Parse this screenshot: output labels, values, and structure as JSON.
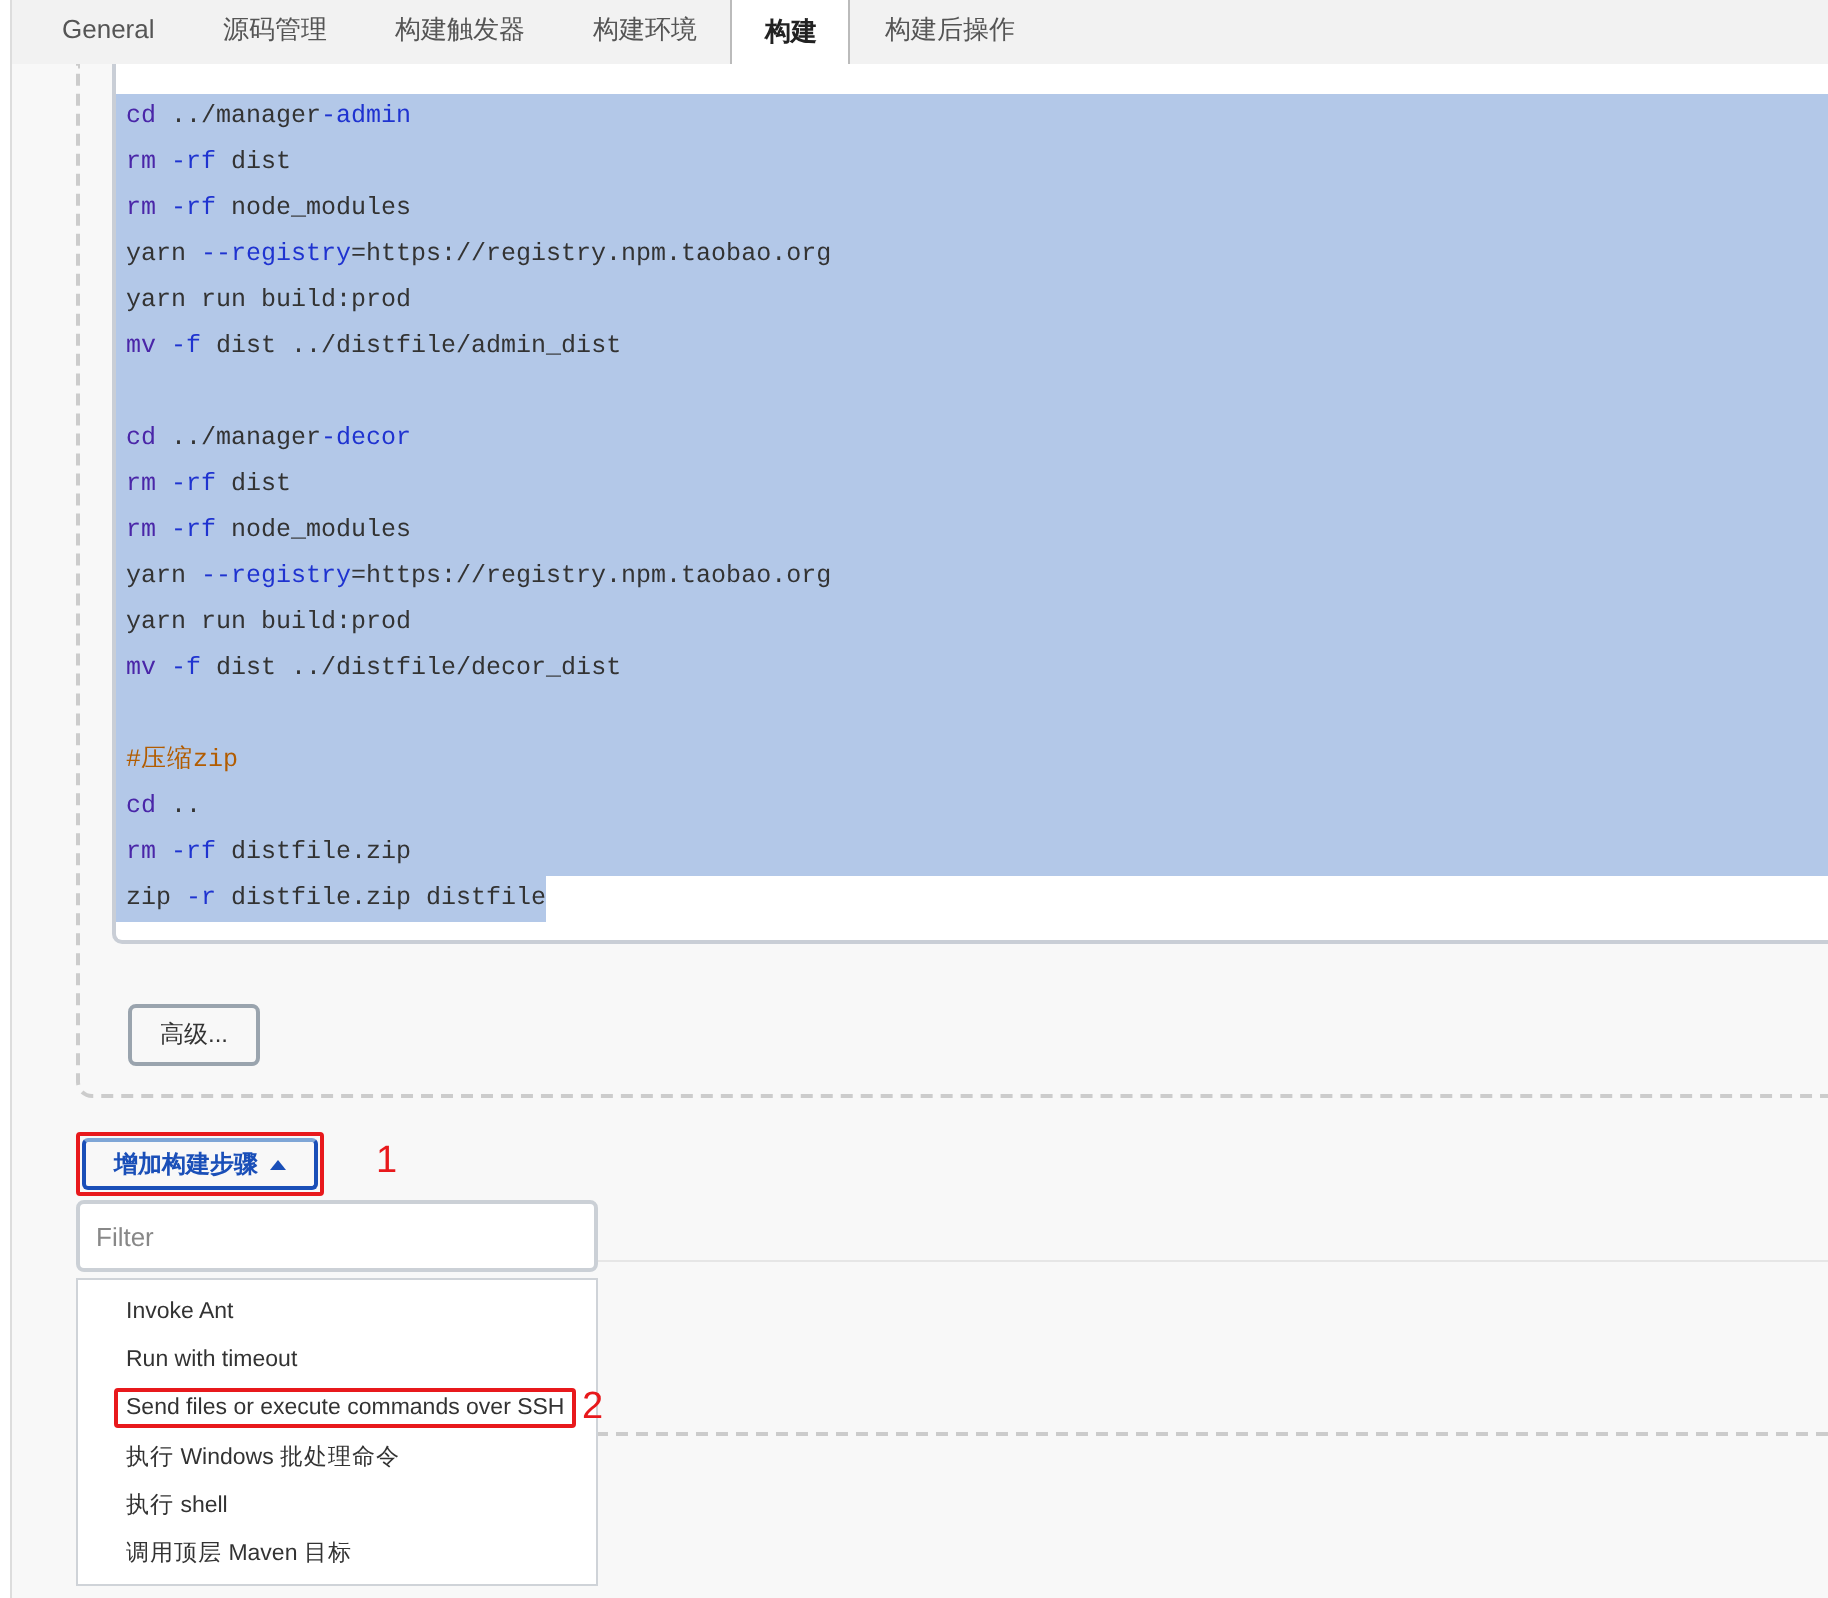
{
  "tabs": [
    {
      "label": "General",
      "selected": false
    },
    {
      "label": "源码管理",
      "selected": false
    },
    {
      "label": "构建触发器",
      "selected": false
    },
    {
      "label": "构建环境",
      "selected": false
    },
    {
      "label": "构建",
      "selected": true
    },
    {
      "label": "构建后操作",
      "selected": false
    }
  ],
  "code_editor": {
    "lines": [
      {
        "selected": true,
        "full_width": true,
        "segments": [
          {
            "text": "cd",
            "kind": "keyword"
          },
          {
            "text": " ../manager",
            "kind": "plain"
          },
          {
            "text": "-admin",
            "kind": "attr"
          }
        ]
      },
      {
        "selected": true,
        "full_width": true,
        "segments": [
          {
            "text": "rm",
            "kind": "keyword"
          },
          {
            "text": " -rf",
            "kind": "attr"
          },
          {
            "text": " dist",
            "kind": "plain"
          }
        ]
      },
      {
        "selected": true,
        "full_width": true,
        "segments": [
          {
            "text": "rm",
            "kind": "keyword"
          },
          {
            "text": " -rf",
            "kind": "attr"
          },
          {
            "text": " node_modules",
            "kind": "plain"
          }
        ]
      },
      {
        "selected": true,
        "full_width": true,
        "segments": [
          {
            "text": "yarn ",
            "kind": "plain"
          },
          {
            "text": "--registry",
            "kind": "attr"
          },
          {
            "text": "=https://registry.npm.taobao.org",
            "kind": "plain"
          }
        ]
      },
      {
        "selected": true,
        "full_width": true,
        "segments": [
          {
            "text": "yarn run build:prod",
            "kind": "plain"
          }
        ]
      },
      {
        "selected": true,
        "full_width": true,
        "segments": [
          {
            "text": "mv",
            "kind": "keyword"
          },
          {
            "text": " -f",
            "kind": "attr"
          },
          {
            "text": " dist ../distfile/admin_dist",
            "kind": "plain"
          }
        ]
      },
      {
        "selected": true,
        "full_width": true
      },
      {
        "selected": true,
        "full_width": true,
        "segments": [
          {
            "text": "cd",
            "kind": "keyword"
          },
          {
            "text": " ../manager",
            "kind": "plain"
          },
          {
            "text": "-decor",
            "kind": "attr"
          }
        ]
      },
      {
        "selected": true,
        "full_width": true,
        "segments": [
          {
            "text": "rm",
            "kind": "keyword"
          },
          {
            "text": " -rf",
            "kind": "attr"
          },
          {
            "text": " dist",
            "kind": "plain"
          }
        ]
      },
      {
        "selected": true,
        "full_width": true,
        "segments": [
          {
            "text": "rm",
            "kind": "keyword"
          },
          {
            "text": " -rf",
            "kind": "attr"
          },
          {
            "text": " node_modules",
            "kind": "plain"
          }
        ]
      },
      {
        "selected": true,
        "full_width": true,
        "segments": [
          {
            "text": "yarn ",
            "kind": "plain"
          },
          {
            "text": "--registry",
            "kind": "attr"
          },
          {
            "text": "=https://registry.npm.taobao.org",
            "kind": "plain"
          }
        ]
      },
      {
        "selected": true,
        "full_width": true,
        "segments": [
          {
            "text": "yarn run build:prod",
            "kind": "plain"
          }
        ]
      },
      {
        "selected": true,
        "full_width": true,
        "segments": [
          {
            "text": "mv",
            "kind": "keyword"
          },
          {
            "text": " -f",
            "kind": "attr"
          },
          {
            "text": " dist ../distfile/decor_dist",
            "kind": "plain"
          }
        ]
      },
      {
        "selected": true,
        "full_width": true
      },
      {
        "selected": true,
        "full_width": true,
        "segments": [
          {
            "text": "#压缩zip",
            "kind": "comment"
          }
        ]
      },
      {
        "selected": true,
        "full_width": true,
        "segments": [
          {
            "text": "cd",
            "kind": "keyword"
          },
          {
            "text": " ..",
            "kind": "plain"
          }
        ]
      },
      {
        "selected": true,
        "full_width": true,
        "segments": [
          {
            "text": "rm",
            "kind": "keyword"
          },
          {
            "text": " -rf",
            "kind": "attr"
          },
          {
            "text": " distfile.zip",
            "kind": "plain"
          }
        ]
      },
      {
        "selected": true,
        "full_width": false,
        "segments": [
          {
            "text": "zip ",
            "kind": "plain"
          },
          {
            "text": "-r",
            "kind": "attr"
          },
          {
            "text": " distfile.zip distfile",
            "kind": "plain"
          }
        ]
      }
    ]
  },
  "advanced_button": {
    "label": "高级..."
  },
  "add_step_button": {
    "label": "增加构建步骤",
    "highlighted": true,
    "annotation": "1"
  },
  "filter_field": {
    "placeholder": "Filter"
  },
  "menu_items": [
    {
      "label": "Invoke Ant",
      "highlighted": false
    },
    {
      "label": "Run with timeout",
      "highlighted": false
    },
    {
      "label": "Send files or execute commands over SSH",
      "highlighted": true,
      "annotation": "2"
    },
    {
      "label": "执行 Windows 批处理命令",
      "highlighted": false
    },
    {
      "label": "执行 shell",
      "highlighted": false
    },
    {
      "label": "调用顶层 Maven 目标",
      "highlighted": false
    }
  ]
}
